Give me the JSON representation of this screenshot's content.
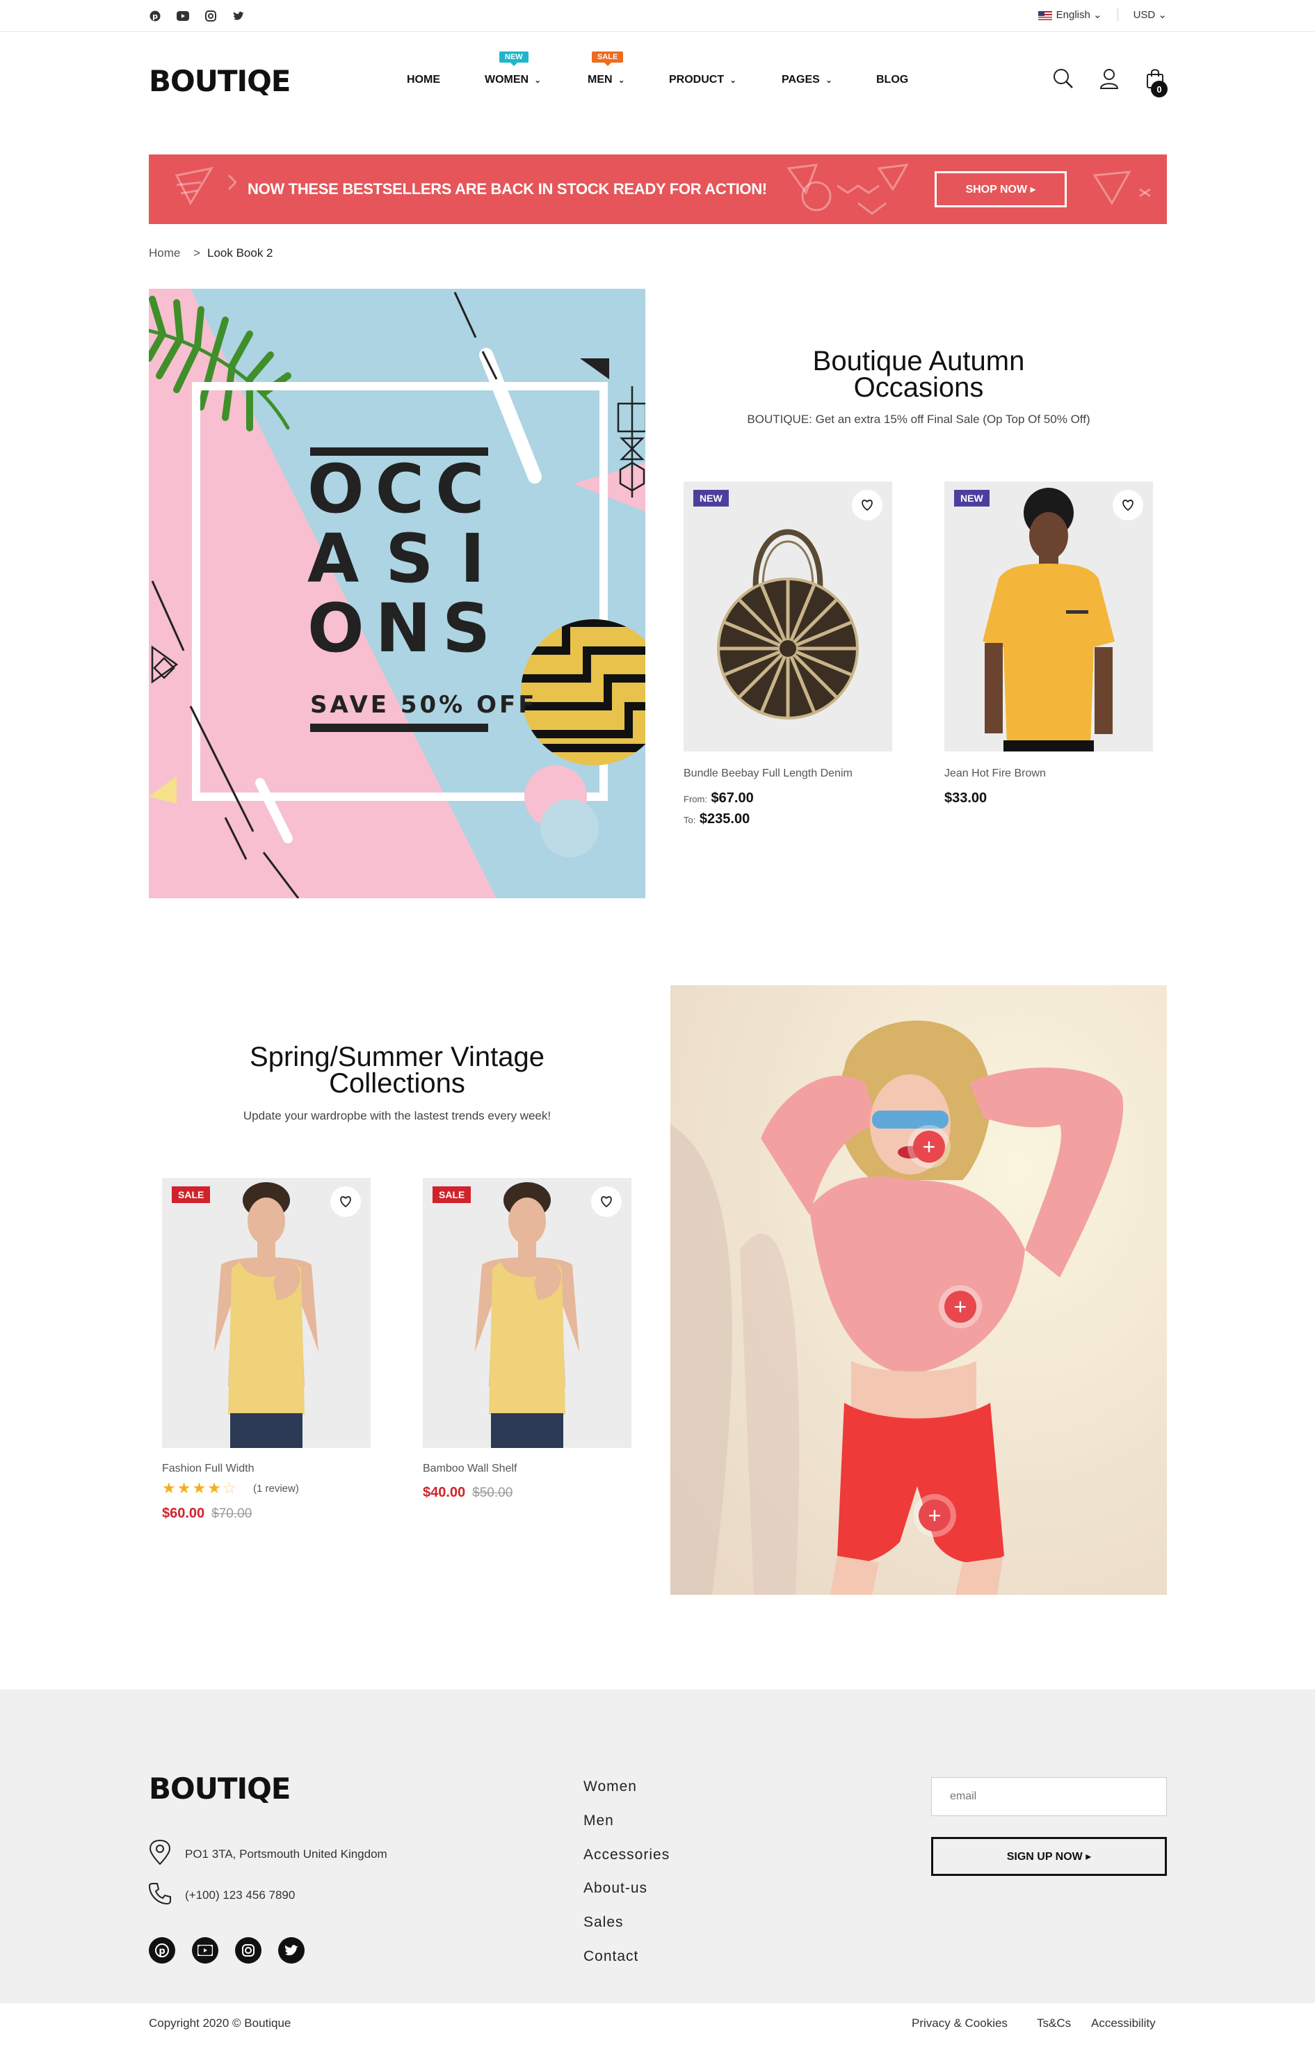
{
  "topbar": {
    "social_icons": [
      "pinterest-icon",
      "youtube-icon",
      "instagram-icon",
      "twitter-icon"
    ],
    "language": "English",
    "currency": "USD"
  },
  "header": {
    "logo": "BOUTIQE",
    "nav": [
      {
        "label": "HOME",
        "badge": "",
        "dropdown": false
      },
      {
        "label": "WOMEN",
        "badge": "NEW",
        "badge_color": "#1fb6c9",
        "dropdown": true
      },
      {
        "label": "MEN",
        "badge": "SALE",
        "badge_color": "#ef6b1f",
        "dropdown": true
      },
      {
        "label": "PRODUCT",
        "badge": "",
        "dropdown": true
      },
      {
        "label": "PAGES",
        "badge": "",
        "dropdown": true
      },
      {
        "label": "BLOG",
        "badge": "",
        "dropdown": false
      }
    ],
    "cart_count": "0",
    "icons": [
      "search-icon",
      "user-icon",
      "bag-icon"
    ]
  },
  "promo": {
    "text": "NOW THESE BESTSELLERS ARE BACK IN STOCK READY FOR ACTION!",
    "button": "SHOP NOW ▸",
    "bg_color": "#e65559"
  },
  "breadcrumb": {
    "home": "Home",
    "separator": ">",
    "current": "Look Book 2"
  },
  "lookbook1": {
    "image_lines": [
      "OCC",
      "ASI",
      "ONS"
    ],
    "image_sub": "SAVE 50% OFF",
    "title_line1": "Boutique Autumn",
    "title_line2": "Occasions",
    "subtitle": "BOUTIQUE: Get an extra 15% off Final Sale (Op Top Of 50% Off)",
    "products": [
      {
        "badge": "NEW",
        "name": "Bundle Beebay Full Length Denim",
        "price_from_label": "From:",
        "price_from": "$67.00",
        "price_to_label": "To:",
        "price_to": "$235.00"
      },
      {
        "badge": "NEW",
        "name": "Jean Hot Fire Brown",
        "price": "$33.00"
      }
    ]
  },
  "lookbook2": {
    "title_line1": "Spring/Summer Vintage",
    "title_line2": "Collections",
    "subtitle": "Update your wardropbe with the lastest trends every week!",
    "products": [
      {
        "badge": "SALE",
        "name": "Fashion Full Width",
        "rating": 4,
        "reviews": "(1 review)",
        "price": "$60.00",
        "old_price": "$70.00"
      },
      {
        "badge": "SALE",
        "name": "Bamboo Wall Shelf",
        "price": "$40.00",
        "old_price": "$50.00"
      }
    ],
    "hotspot_symbol": "+"
  },
  "footer": {
    "logo": "BOUTIQE",
    "address": "PO1 3TA, Portsmouth United Kingdom",
    "phone": "(+100) 123 456 7890",
    "links": [
      "Women",
      "Men",
      "Accessories",
      "About-us",
      "Sales",
      "Contact"
    ],
    "email_placeholder": "email",
    "signup_button": "SIGN UP NOW ▸",
    "copyright": "Copyright 2020 © Boutique",
    "legal_links": [
      "Privacy & Cookies",
      "Ts&Cs",
      "Accessibility"
    ]
  },
  "colors": {
    "accent_red": "#e65559",
    "sale_red": "#d0232b",
    "new_badge": "#4b3f9e",
    "star": "#f2b01e"
  }
}
